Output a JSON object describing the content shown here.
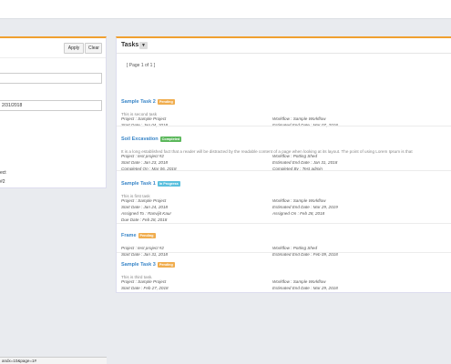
{
  "filters": {
    "apply_label": "Apply",
    "clear_label": "Clear",
    "date_value_1": "",
    "date_value_2": "2/31/2018",
    "option_1": "ect",
    "option_2": "#2"
  },
  "tasks_panel": {
    "title": "Tasks",
    "filter_icon": "▼",
    "pager": "[ Page 1 of 1 ]"
  },
  "tasks": [
    {
      "name": "Sample Task 2",
      "badge": "Pending",
      "description": "This is second task",
      "project": "Project : Sample Project",
      "workflow": "Workflow : Sample Workflow",
      "start": "Start Date : Jan 04, 2018",
      "end": "Estimated End Date : Mar 07, 2018"
    },
    {
      "name": "Soil Excavation",
      "badge": "Completed",
      "description": "It is a long established fact that a reader will be distracted by the readable content of a page when looking at its layout. The point of using Lorem Ipsum is that",
      "project": "Project : test project #2",
      "workflow": "Workflow : Potting Shed",
      "start": "Start Date : Jan 23, 2018",
      "end": "Estimated End Date : Jan 31, 2018",
      "completed_on": "Completed On : Mar 06, 2018",
      "completed_by": "Completed By : Test admin"
    },
    {
      "name": "Sample Task 1",
      "badge": "In Progress",
      "description": "This is first task",
      "project": "Project : Sample Project",
      "workflow": "Workflow : Sample Workflow",
      "start": "Start Date : Jan 24, 2018",
      "end": "Estimated End Date : Mar 29, 2019",
      "assigned_to": "Assigned To : Ranvijit Kaur",
      "assigned_on": "Assigned On : Feb 28, 2018",
      "due": "Due Date : Feb 28, 2018"
    },
    {
      "name": "Frame",
      "badge": "Pending",
      "project": "Project : test project #2",
      "workflow": "Workflow : Potting Shed",
      "start": "Start Date : Jan 31, 2018",
      "end": "Estimated End Date : Feb 09, 2018"
    },
    {
      "name": "Sample Task 3",
      "badge": "Pending",
      "description": "This is third task.",
      "project": "Project : Sample Project",
      "workflow": "Workflow : Sample Workflow",
      "start": "Start Date : Feb 27, 2018",
      "end": "Estimated End Date : Mar 29, 2018"
    }
  ],
  "statusbar": "andx=10&page=1#"
}
